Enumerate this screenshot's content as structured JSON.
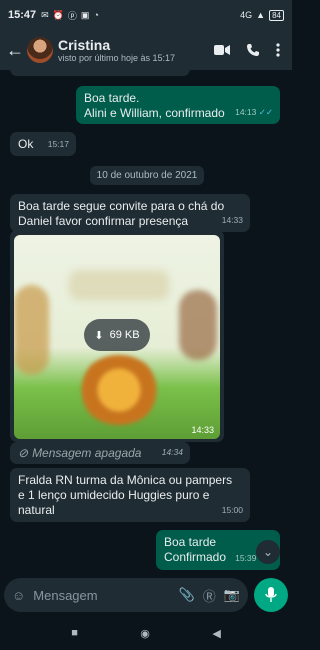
{
  "status_bar": {
    "time": "15:47",
    "battery": "84",
    "network": "4G"
  },
  "contact": {
    "name": "Cristina",
    "status": "visto por último hoje às 15:17"
  },
  "messages": [
    {
      "text": "Boa tarde.\nAlini e William, confirmado",
      "time": "14:13",
      "direction": "out",
      "ticks": "read"
    },
    {
      "text": "Ok",
      "time": "15:17",
      "direction": "in"
    },
    {
      "text": "Boa tarde segue convite para o chá do Daniel favor confirmar presença",
      "time": "14:33",
      "direction": "in"
    },
    {
      "type": "image",
      "size": "69 KB",
      "time": "14:33",
      "direction": "in"
    },
    {
      "text": "Mensagem apagada",
      "time": "14:34",
      "direction": "in",
      "deleted": true
    },
    {
      "text": "Fralda RN turma da Mônica ou pampers e 1 lenço umidecido Huggies puro e natural",
      "time": "15:00",
      "direction": "in"
    },
    {
      "text": "Boa tarde\nConfirmado",
      "time": "15:39",
      "direction": "out",
      "ticks": "read"
    }
  ],
  "date_separator": "10 de outubro de 2021",
  "composer": {
    "placeholder": "Mensagem"
  },
  "colors": {
    "accent": "#00a884",
    "outgoing": "#005c4b",
    "incoming": "#202c33",
    "background": "#0b141a",
    "read_tick": "#53bdeb"
  }
}
